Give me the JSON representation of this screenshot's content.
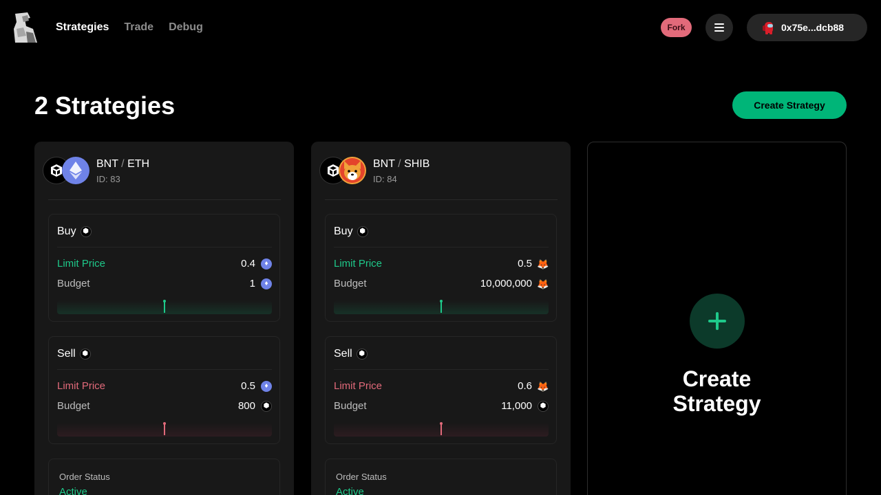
{
  "header": {
    "nav": [
      "Strategies",
      "Trade",
      "Debug"
    ],
    "fork_label": "Fork",
    "wallet_address": "0x75e...dcb88"
  },
  "page": {
    "title": "2 Strategies",
    "create_button": "Create Strategy"
  },
  "strategies": [
    {
      "base": "BNT",
      "separator": "/",
      "quote": "ETH",
      "id_label": "ID: 83",
      "buy": {
        "title": "Buy",
        "limit_label": "Limit Price",
        "limit_value": "0.4",
        "limit_token": "eth-icon",
        "budget_label": "Budget",
        "budget_value": "1",
        "budget_token": "eth-icon",
        "marker_fraction": 0.5
      },
      "sell": {
        "title": "Sell",
        "limit_label": "Limit Price",
        "limit_value": "0.5",
        "limit_token": "eth-icon",
        "budget_label": "Budget",
        "budget_value": "800",
        "budget_token": "bnt-icon",
        "marker_fraction": 0.5
      },
      "status_label": "Order Status",
      "status_value": "Active"
    },
    {
      "base": "BNT",
      "separator": "/",
      "quote": "SHIB",
      "id_label": "ID: 84",
      "buy": {
        "title": "Buy",
        "limit_label": "Limit Price",
        "limit_value": "0.5",
        "limit_token": "shib-icon",
        "budget_label": "Budget",
        "budget_value": "10,000,000",
        "budget_token": "shib-icon",
        "marker_fraction": 0.5
      },
      "sell": {
        "title": "Sell",
        "limit_label": "Limit Price",
        "limit_value": "0.6",
        "limit_token": "shib-icon",
        "budget_label": "Budget",
        "budget_value": "11,000",
        "budget_token": "bnt-icon",
        "marker_fraction": 0.5
      },
      "status_label": "Order Status",
      "status_value": "Active"
    }
  ],
  "create_card": {
    "line1": "Create",
    "line2": "Strategy"
  },
  "colors": {
    "accent_green": "#00b578",
    "buy_green": "#1ec98a",
    "sell_red": "#e26a7a",
    "fork_badge": "#e26a7a"
  }
}
